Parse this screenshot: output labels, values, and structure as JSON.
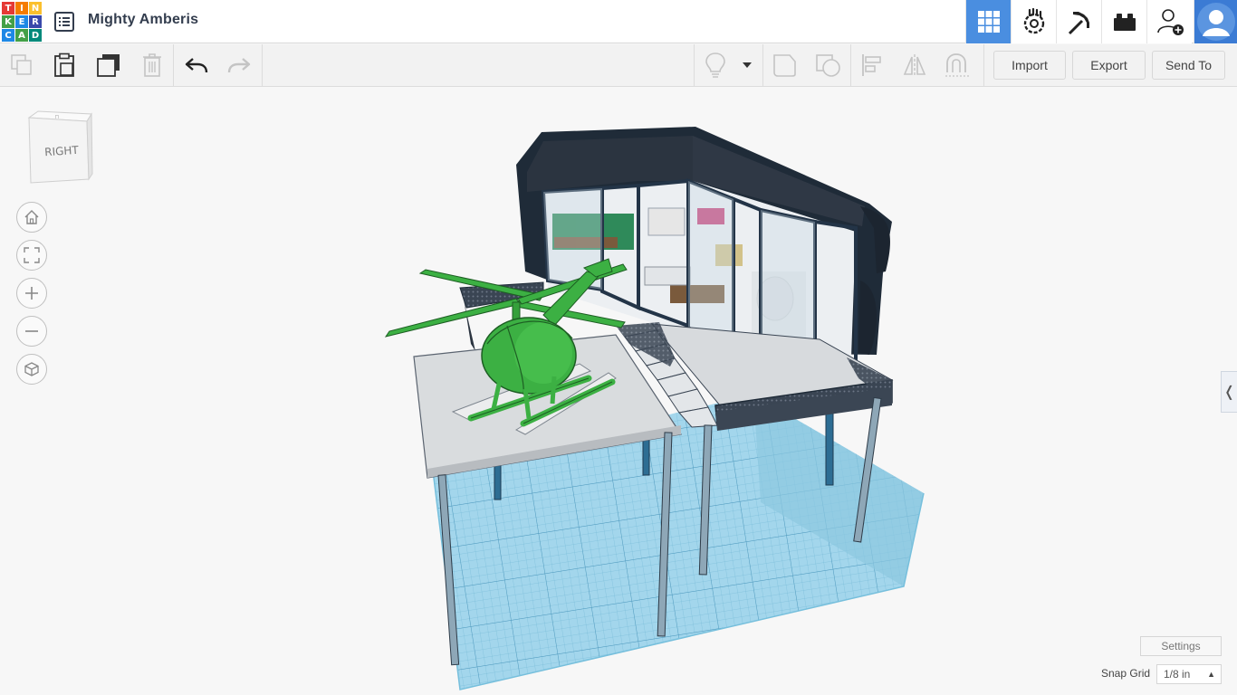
{
  "app": {
    "logo_letters": [
      "T",
      "I",
      "N",
      "K",
      "E",
      "R",
      "C",
      "A",
      "D"
    ],
    "logo_colors": [
      "#e53935",
      "#f57c00",
      "#fbc02d",
      "#43a047",
      "#1e88e5",
      "#3949ab",
      "#1e88e5",
      "#43a047",
      "#00897b"
    ]
  },
  "header": {
    "design_name": "Mighty Amberis",
    "menu_icon": "list-icon",
    "view_buttons": [
      {
        "name": "3d-design-view",
        "icon": "grid-icon",
        "active": true
      },
      {
        "name": "codeblocks-view",
        "icon": "gear-hand-icon",
        "active": false
      },
      {
        "name": "minecraft-view",
        "icon": "pickaxe-icon",
        "active": false
      },
      {
        "name": "lego-bricks-view",
        "icon": "brick-icon",
        "active": false
      }
    ],
    "add_user_icon": "add-user-icon",
    "avatar_icon": "user-avatar-icon"
  },
  "toolbar": {
    "left_tools": [
      "copy-icon",
      "paste-icon",
      "duplicate-icon",
      "delete-icon",
      "undo-icon",
      "redo-icon"
    ],
    "right_tools": [
      "light-bulb-icon",
      "dropdown-caret-icon",
      "group-icon",
      "ungroup-icon",
      "align-icon",
      "mirror-icon",
      "magnet-icon"
    ],
    "import_label": "Import",
    "export_label": "Export",
    "send_to_label": "Send To"
  },
  "viewcube": {
    "face_label": "RIGHT"
  },
  "nav_buttons": [
    "home-icon",
    "fit-all-icon",
    "zoom-in-icon",
    "zoom-out-icon",
    "ortho-view-icon"
  ],
  "side_tab": {
    "glyph": "❬"
  },
  "footer": {
    "settings_label": "Settings",
    "snap_grid_label": "Snap Grid",
    "snap_grid_value": "1/8 in"
  },
  "colors": {
    "accent": "#4a8ee0",
    "workplane": "#9fd3ea",
    "grid_lines": "#5fa8c9",
    "helicopter": "#3cb043",
    "building_frame": "#1f2b38",
    "platform": "#d9dcde"
  }
}
